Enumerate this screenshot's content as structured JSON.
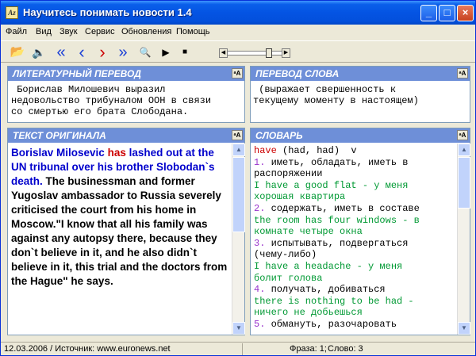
{
  "window": {
    "title": "Научитесь понимать новости 1.4",
    "minimize": "_",
    "maximize": "□",
    "close": "×"
  },
  "menu": [
    "Файл",
    "Вид",
    "Звук",
    "Сервис",
    "Обновления",
    "Помощь"
  ],
  "toolbar": {
    "open": "📂",
    "sound": "🔈",
    "first": "«",
    "prev": "‹",
    "next": "›",
    "last": "»",
    "search": "🔍",
    "play": "▶",
    "stop": "■",
    "slider_position": 0.8
  },
  "literary_panel": {
    "title": "ЛИТЕРАТУРНЫЙ ПЕРЕВОД",
    "font_button": "ᵃA",
    "lines": [
      " Борислав Милошевич выразил",
      "недовольство трибуналом ООН в связи",
      "со смертью его брата Слободана."
    ]
  },
  "word_panel": {
    "title": "ПЕРЕВОД СЛОВА",
    "font_button": "ᵃA",
    "lines": [
      " (выражает свершенность к",
      "текущему моменту в настоящем)"
    ]
  },
  "original_panel": {
    "title": "ТЕКСТ ОРИГИНАЛА",
    "font_button": "ᵃA",
    "seg_name": "Borislav Milosevic",
    "seg_has": "has",
    "seg_lashed": "lashed out at the UN tribunal over his brother Slobodan`s death.",
    "seg_rest": " The businessman and former Yugoslav ambassador to Russia severely criticised the court from his home in Moscow.\"I know that all his family was against any autopsy there, because they don`t believe in it, and he also didn`t believe in it, this trial and the doctors from the Hague\" he says."
  },
  "dictionary_panel": {
    "title": "СЛОВАРЬ",
    "font_button": "ᵃA",
    "headword": "have",
    "forms": " (had, had)  v",
    "entries": [
      {
        "num": "1.",
        "text": " иметь, обладать, иметь в",
        "cont": "распоряжении",
        "example": [
          "I have a good flat - у меня",
          "хорошая квартира"
        ]
      },
      {
        "num": "2.",
        "text": " содержать, иметь в составе",
        "cont": "",
        "example": [
          "the room has four windows - в",
          "комнате четыре окна"
        ]
      },
      {
        "num": "3.",
        "text": " испытывать, подвергаться",
        "cont": "(чему-либо)",
        "example": [
          "I have a headache - у меня",
          "болит голова"
        ]
      },
      {
        "num": "4.",
        "text": " получать, добиваться",
        "cont": "",
        "example": [
          "there is nothing to be had -",
          "ничего не добьешься"
        ]
      },
      {
        "num": "5.",
        "text": " обмануть, разочаровать",
        "cont": "",
        "example": []
      }
    ]
  },
  "status": {
    "source": "12.03.2006 / Источник: www.euronews.net",
    "phrase": "Фраза: 1;",
    "word": "Слово: 3"
  },
  "colors": {
    "titlebar": "#0454e3",
    "panel_header": "#6e8fd8",
    "headword": "#cc0000",
    "sense_number": "#9933cc",
    "example": "#009933",
    "original_blue": "#0000cc",
    "original_red": "#cc0000"
  }
}
